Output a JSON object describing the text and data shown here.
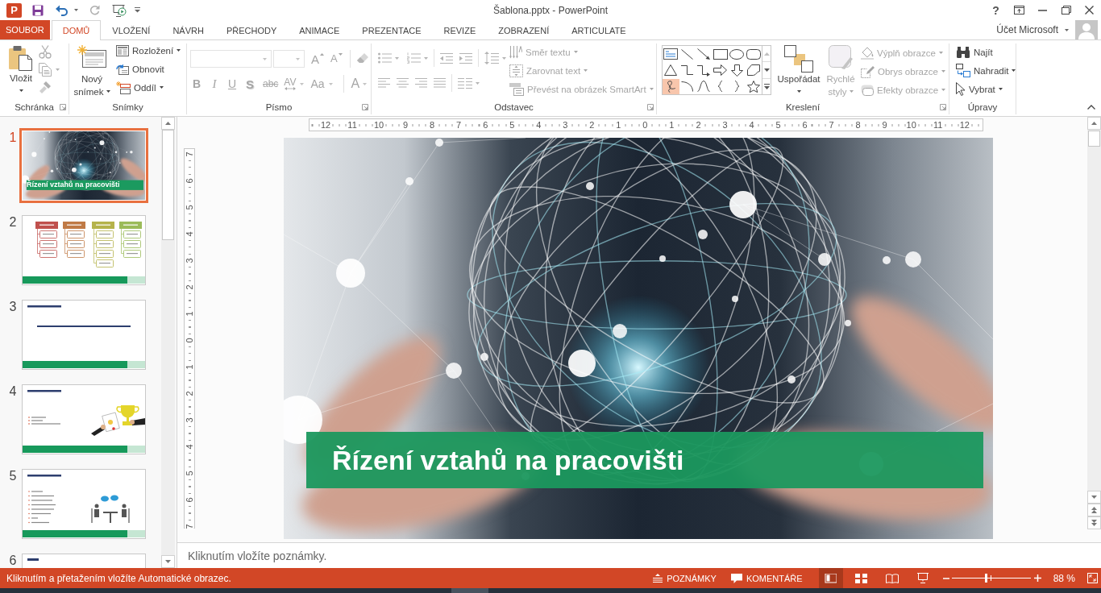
{
  "title_bar": {
    "logo": "P",
    "quick_access": [
      {
        "disabled": false
      },
      {
        "disabled": false
      },
      {
        "disabled": true
      },
      {
        "disabled": false
      }
    ],
    "title": "Šablona.pptx - PowerPoint",
    "help": "?"
  },
  "tabs": [
    {
      "label": "SOUBOR",
      "kind": "file",
      "selected": false
    },
    {
      "label": "DOMŮ",
      "kind": "tab",
      "selected": true
    },
    {
      "label": "VLOŽENÍ",
      "kind": "tab",
      "selected": false
    },
    {
      "label": "NÁVRH",
      "kind": "tab",
      "selected": false
    },
    {
      "label": "PŘECHODY",
      "kind": "tab",
      "selected": false
    },
    {
      "label": "ANIMACE",
      "kind": "tab",
      "selected": false
    },
    {
      "label": "PREZENTACE",
      "kind": "tab",
      "selected": false
    },
    {
      "label": "REVIZE",
      "kind": "tab",
      "selected": false
    },
    {
      "label": "ZOBRAZENÍ",
      "kind": "tab",
      "selected": false
    },
    {
      "label": "ARTICULATE",
      "kind": "tab",
      "selected": false
    }
  ],
  "account": {
    "label": "Účet Microsoft"
  },
  "ribbon": {
    "clipboard": {
      "label": "Schránka",
      "paste": {
        "label": "Vložit",
        "disabled": false
      },
      "tools": [
        {
          "disabled": true
        },
        {
          "disabled": true
        },
        {
          "disabled": true
        }
      ]
    },
    "slides": {
      "label": "Snímky",
      "new_slide": "Nový snímek",
      "items": [
        "Rozložení",
        "Obnovit",
        "Oddíl"
      ]
    },
    "font": {
      "label": "Písmo",
      "disabled": true,
      "size_buttons": [
        "A",
        "A"
      ],
      "format_buttons": [
        "B",
        "I",
        "U",
        "S",
        "abc",
        "AV",
        "Aa"
      ],
      "color_button": "A"
    },
    "paragraph": {
      "label": "Odstavec",
      "disabled": true,
      "text_buttons": [
        "Směr textu",
        "Zarovnat text",
        "Převést na obrázek SmartArt"
      ]
    },
    "drawing": {
      "label": "Kreslení",
      "shapes": [
        {
          "selected": false
        },
        {
          "selected": false
        },
        {
          "selected": false
        },
        {
          "selected": false
        },
        {
          "selected": false
        },
        {
          "selected": false
        },
        {
          "selected": false
        },
        {
          "selected": false
        },
        {
          "selected": false
        },
        {
          "selected": false
        },
        {
          "selected": false
        },
        {
          "selected": false
        },
        {
          "selected": true
        },
        {
          "selected": false
        },
        {
          "selected": false
        },
        {
          "selected": false
        },
        {
          "selected": false
        },
        {
          "selected": false
        }
      ],
      "buttons": [
        {
          "label": "Uspořádat",
          "disabled": false
        },
        {
          "label": "Rychlé styly",
          "disabled": true
        }
      ],
      "shape_format": [
        {
          "label": "Výplň obrazce",
          "disabled": true
        },
        {
          "label": "Obrys obrazce",
          "disabled": true
        },
        {
          "label": "Efekty obrazce",
          "disabled": true
        }
      ]
    },
    "editing": {
      "label": "Úpravy",
      "items": [
        "Najít",
        "Nahradit",
        "Vybrat"
      ]
    }
  },
  "slides_pane": {
    "slides": [
      {
        "number": "1",
        "kind": "title",
        "selected": true,
        "title": "Řízení vztahů na pracovišti"
      },
      {
        "number": "2",
        "kind": "diagram",
        "selected": false
      },
      {
        "number": "3",
        "kind": "text",
        "selected": false
      },
      {
        "number": "4",
        "kind": "award",
        "selected": false
      },
      {
        "number": "5",
        "kind": "meeting",
        "selected": false
      },
      {
        "number": "6",
        "kind": "partial",
        "selected": false
      }
    ]
  },
  "editor": {
    "ruler_h": [
      "12",
      "11",
      "10",
      "9",
      "8",
      "7",
      "6",
      "5",
      "4",
      "3",
      "2",
      "1",
      "0",
      "1",
      "2",
      "3",
      "4",
      "5",
      "6",
      "7",
      "8",
      "9",
      "10",
      "11",
      "12"
    ],
    "ruler_v": [
      "7",
      "6",
      "5",
      "4",
      "3",
      "2",
      "1",
      "0",
      "1",
      "2",
      "3",
      "4",
      "5",
      "6",
      "7"
    ],
    "slide": {
      "title": "Řízení vztahů na pracovišti"
    }
  },
  "notes": {
    "placeholder": "Kliknutím vložíte poznámky."
  },
  "status_bar": {
    "message": "Kliknutím a přetažením vložíte Automatické obrazec.",
    "buttons": [
      "POZNÁMKY",
      "KOMENTÁŘE"
    ],
    "views": [
      {
        "selected": true
      },
      {
        "selected": false
      },
      {
        "selected": false
      },
      {
        "selected": false
      }
    ],
    "zoom": {
      "level": 0.44,
      "reading": "88 %"
    }
  }
}
